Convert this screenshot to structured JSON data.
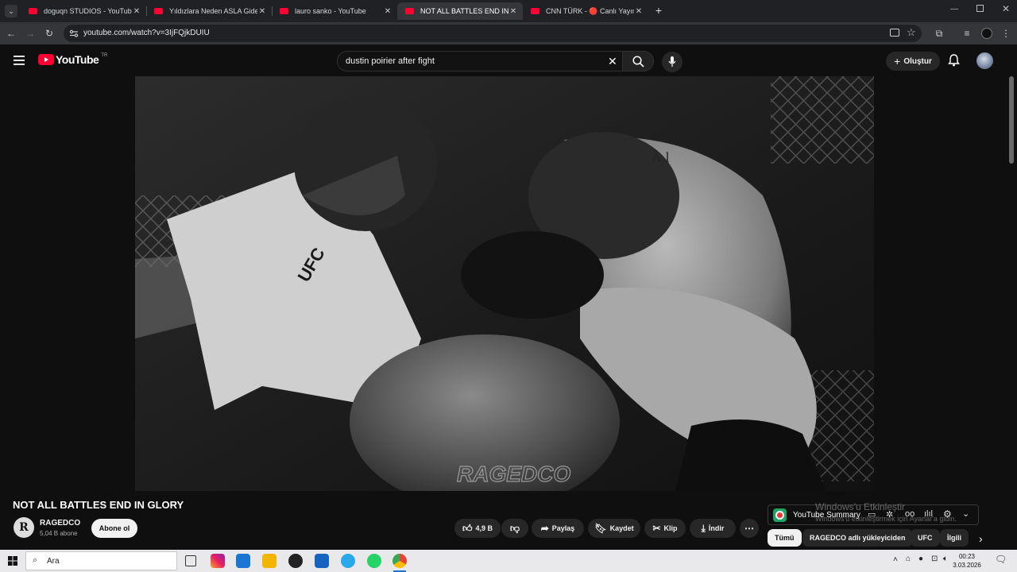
{
  "browser": {
    "tabs": [
      {
        "title": "doguqn STUDIOS - YouTube"
      },
      {
        "title": "Yıldızlara Neden ASLA Gidemey"
      },
      {
        "title": "lauro sanko - YouTube"
      },
      {
        "title": "NOT ALL BATTLES END IN GLORY",
        "active": true
      },
      {
        "title": "CNN TÜRK - 🔴 Canlı Yayın ᴴᴰ"
      }
    ],
    "new_tab_label": "+",
    "url": "youtube.com/watch?v=3IjFQjkDUIU"
  },
  "youtube": {
    "logo_text": "YouTube",
    "region": "TR",
    "search": {
      "query": "dustin poirier after fight"
    },
    "create_label": "Oluştur"
  },
  "video": {
    "watermark": "RAGEDCO",
    "logo_on_shirt": "UFC",
    "tattoo_text": "A.l"
  },
  "details": {
    "title": "NOT ALL BATTLES END IN GLORY",
    "channel": {
      "avatar_letter": "R",
      "name": "RAGEDCO",
      "subscribers": "5,04 B abone"
    },
    "subscribe_label": "Abone ol",
    "like_count": "4,9 B",
    "share_label": "Paylaş",
    "save_label": "Kaydet",
    "clip_label": "Klip",
    "download_label": "İndir"
  },
  "sidebar": {
    "summary_title": "YouTube Summary",
    "chips": [
      "Tümü",
      "RAGEDCO adlı yükleyiciden",
      "UFC",
      "İlgili"
    ]
  },
  "windows_notice": {
    "line1": "Windows'u Etkinleştir",
    "line2": "Windows'u etkinleştirmek için Ayarlar'a gidin."
  },
  "taskbar": {
    "search_placeholder": "Ara",
    "time": "00:23",
    "date": "3.03.2026"
  }
}
